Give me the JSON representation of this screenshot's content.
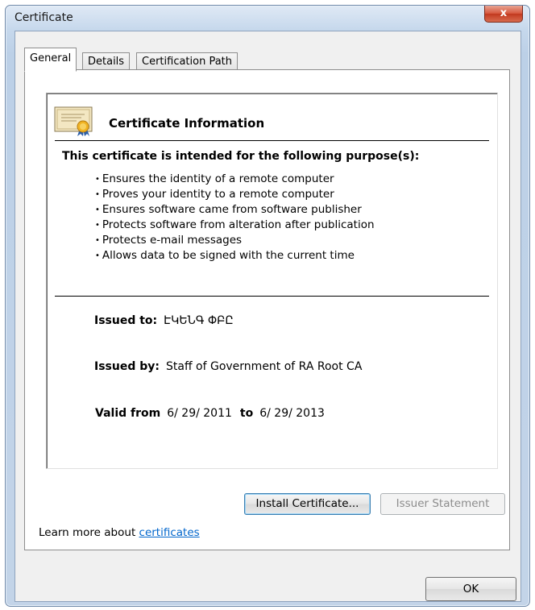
{
  "window": {
    "title": "Certificate",
    "close_label": "x"
  },
  "tabs": [
    {
      "label": "General",
      "active": true
    },
    {
      "label": "Details",
      "active": false
    },
    {
      "label": "Certification Path",
      "active": false
    }
  ],
  "general": {
    "info_title": "Certificate Information",
    "purpose_heading": "This certificate is intended for the following purpose(s):",
    "bullet": "•",
    "purposes": [
      "Ensures the identity of a remote computer",
      "Proves your identity to a remote computer",
      "Ensures software came from software publisher",
      "Protects software from alteration after publication",
      "Protects e-mail messages",
      "Allows data to be signed with the current time"
    ],
    "issued_to_label": "Issued to:",
    "issued_to_value": "ԷԿԵՆԳ ՓԲԸ",
    "issued_by_label": "Issued by:",
    "issued_by_value": "Staff of Government of RA Root CA",
    "valid_from_label": "Valid from",
    "valid_from_value": "6/ 29/ 2011",
    "valid_to_label": "to",
    "valid_to_value": "6/ 29/ 2013"
  },
  "buttons": {
    "install": "Install Certificate...",
    "issuer_statement": "Issuer Statement",
    "ok": "OK"
  },
  "learn_more": {
    "prefix": "Learn more about ",
    "link": "certificates"
  },
  "colors": {
    "link": "#0066cc",
    "close_button": "#c2391f"
  },
  "icons": [
    "certificate-icon",
    "close-icon"
  ]
}
